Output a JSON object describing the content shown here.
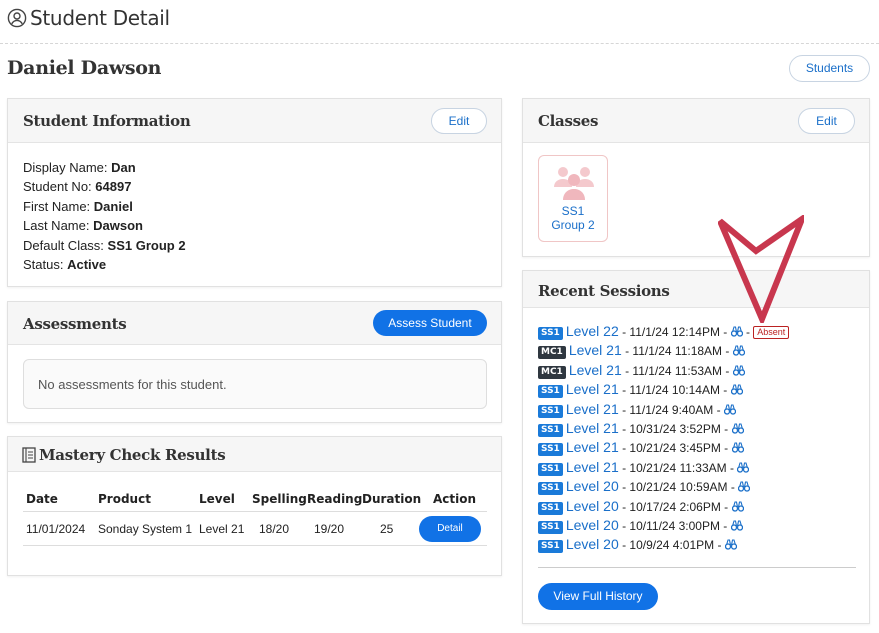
{
  "header": {
    "title": "Student Detail",
    "icon": "user-circle-icon"
  },
  "student": {
    "name": "Daniel Dawson"
  },
  "students_button": "Students",
  "info": {
    "title": "Student Information",
    "edit_label": "Edit",
    "fields": [
      {
        "label": "Display Name:",
        "value": "Dan"
      },
      {
        "label": "Student No:",
        "value": "64897"
      },
      {
        "label": "First Name:",
        "value": "Daniel"
      },
      {
        "label": "Last Name:",
        "value": "Dawson"
      },
      {
        "label": "Default Class:",
        "value": "SS1 Group 2"
      },
      {
        "label": "Status:",
        "value": "Active"
      }
    ]
  },
  "assessments": {
    "title": "Assessments",
    "button": "Assess Student",
    "empty": "No assessments for this student."
  },
  "mastery": {
    "title": "Mastery Check Results",
    "columns": [
      "Date",
      "Product",
      "Level",
      "Spelling",
      "Reading",
      "Duration",
      "Action"
    ],
    "rows": [
      {
        "date": "11/01/2024",
        "product": "Sonday System 1",
        "level": "Level 21",
        "spelling": "18/20",
        "reading": "19/20",
        "duration": "25",
        "action": "Detail"
      }
    ]
  },
  "classes": {
    "title": "Classes",
    "edit_label": "Edit",
    "items": [
      {
        "line1": "SS1",
        "line2": "Group 2"
      }
    ]
  },
  "sessions": {
    "title": "Recent Sessions",
    "items": [
      {
        "badge": "SS1",
        "level": "Level 22",
        "time": " - 11/1/24 12:14PM - ",
        "status": "Absent"
      },
      {
        "badge": "MC1",
        "level": "Level 21",
        "time": " - 11/1/24 11:18AM - ",
        "status": ""
      },
      {
        "badge": "MC1",
        "level": "Level 21",
        "time": " - 11/1/24 11:53AM - ",
        "status": ""
      },
      {
        "badge": "SS1",
        "level": "Level 21",
        "time": " - 11/1/24 10:14AM - ",
        "status": ""
      },
      {
        "badge": "SS1",
        "level": "Level 21",
        "time": " - 11/1/24 9:40AM - ",
        "status": ""
      },
      {
        "badge": "SS1",
        "level": "Level 21",
        "time": " - 10/31/24 3:52PM - ",
        "status": ""
      },
      {
        "badge": "SS1",
        "level": "Level 21",
        "time": " - 10/21/24 3:45PM - ",
        "status": ""
      },
      {
        "badge": "SS1",
        "level": "Level 21",
        "time": " - 10/21/24 11:33AM - ",
        "status": ""
      },
      {
        "badge": "SS1",
        "level": "Level 20",
        "time": " - 10/21/24 10:59AM - ",
        "status": ""
      },
      {
        "badge": "SS1",
        "level": "Level 20",
        "time": " - 10/17/24 2:06PM - ",
        "status": ""
      },
      {
        "badge": "SS1",
        "level": "Level 20",
        "time": " - 10/11/24 3:00PM - ",
        "status": ""
      },
      {
        "badge": "SS1",
        "level": "Level 20",
        "time": " - 10/9/24 4:01PM - ",
        "status": ""
      }
    ],
    "history_button": "View Full History"
  },
  "colors": {
    "primary": "#1172e6",
    "link": "#1a6fc9",
    "badge_ss": "#1a7ad9",
    "badge_mc": "#2f3740",
    "absent": "#bb2222",
    "arrow": "#c8374e"
  }
}
